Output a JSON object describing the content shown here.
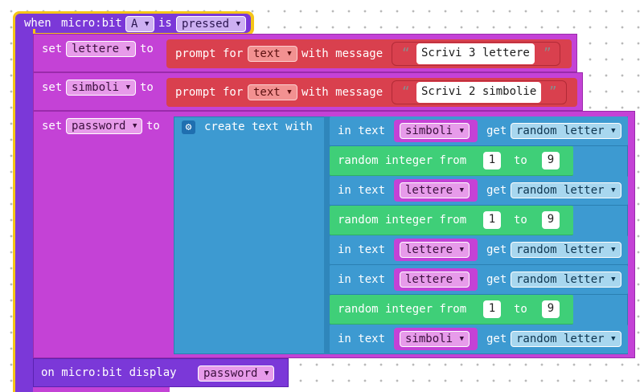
{
  "event": {
    "when_label": "when",
    "microbit_label": "micro:bit",
    "button": "A",
    "is_label": "is",
    "action": "pressed"
  },
  "set_lettere": {
    "set_label": "set",
    "var": "lettere",
    "to_label": "to",
    "prompt_label": "prompt for",
    "type": "text",
    "with_message": "with message",
    "message": "Scrivi 3 lettere"
  },
  "set_simboli": {
    "set_label": "set",
    "var": "simboli",
    "to_label": "to",
    "prompt_label": "prompt for",
    "type": "text",
    "with_message": "with message",
    "message": "Scrivi 2 simbolie"
  },
  "set_password": {
    "set_label": "set",
    "var": "password",
    "to_label": "to",
    "create_label": "create text with"
  },
  "text_items": [
    {
      "kind": "in_text",
      "in_label": "in text",
      "var": "simboli",
      "get_label": "get",
      "getter": "random letter"
    },
    {
      "kind": "random",
      "label": "random integer from",
      "from": "1",
      "to_label": "to",
      "to": "9"
    },
    {
      "kind": "in_text",
      "in_label": "in text",
      "var": "lettere",
      "get_label": "get",
      "getter": "random letter"
    },
    {
      "kind": "random",
      "label": "random integer from",
      "from": "1",
      "to_label": "to",
      "to": "9"
    },
    {
      "kind": "in_text",
      "in_label": "in text",
      "var": "lettere",
      "get_label": "get",
      "getter": "random letter"
    },
    {
      "kind": "in_text",
      "in_label": "in text",
      "var": "lettere",
      "get_label": "get",
      "getter": "random letter"
    },
    {
      "kind": "random",
      "label": "random integer from",
      "from": "1",
      "to_label": "to",
      "to": "9"
    },
    {
      "kind": "in_text",
      "in_label": "in text",
      "var": "simboli",
      "get_label": "get",
      "getter": "random letter"
    }
  ],
  "display": {
    "label": "on micro:bit display",
    "var": "password"
  },
  "icons": {
    "gear": "gear-icon",
    "dropdown": "dropdown-caret-icon",
    "quote_open": "quote-open-icon",
    "quote_close": "quote-close-icon"
  },
  "colors": {
    "event_block": "#7b38d8",
    "event_highlight": "#f5c518",
    "variable_block": "#c442d6",
    "prompt_block": "#d9404e",
    "create_text_block": "#3d9ad1",
    "random_block": "#3fcf78",
    "display_block": "#7b38d8"
  }
}
